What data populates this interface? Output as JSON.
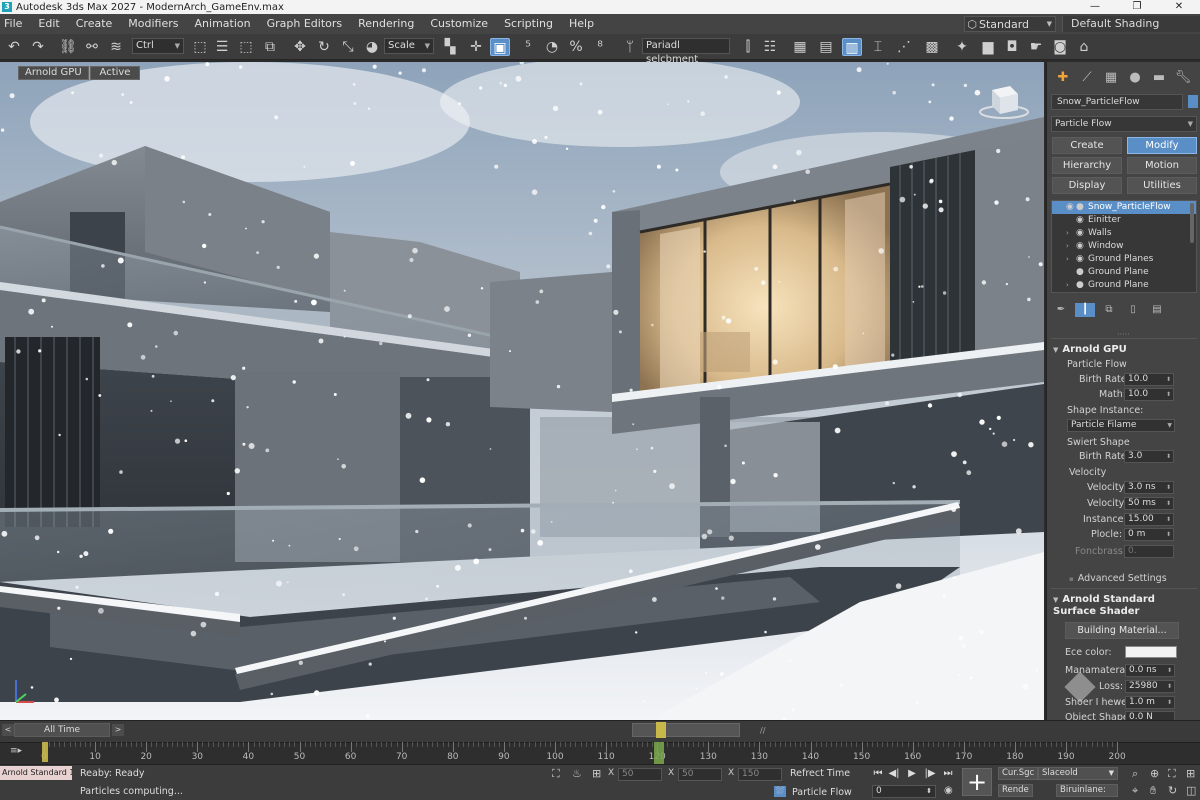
{
  "window": {
    "title": "Autodesk 3ds Max 2027 - ModernArch_GameEnv.max",
    "app_icon": "3",
    "minimize": "—",
    "restore": "❐",
    "close": "✕"
  },
  "menu": [
    "File",
    "Edit",
    "Create",
    "Modifiers",
    "Animation",
    "Graph Editors",
    "Rendering",
    "Customize",
    "Scripting",
    "Help"
  ],
  "workspace": {
    "label": "Standard",
    "shading": "Default Shading"
  },
  "toolbar": {
    "selection_filter": "Ctrl",
    "transform_dropdown": "Scale",
    "named_selection": "Pariadl selcbment"
  },
  "viewport": {
    "renderer_label": "Arnold GPU",
    "state_label": "Active",
    "scene": "Snowy modern concrete architecture with glass railings and lit window"
  },
  "command_panel": {
    "object_name": "Snow_ParticleFlow",
    "modifier_list": "Particle Flow",
    "buttons": [
      "Create",
      "Modify",
      "Hierarchy",
      "Motion",
      "Display",
      "Utilities"
    ],
    "active_button": "Modify",
    "tree": [
      {
        "name": "Snow_ParticleFlow",
        "selected": true,
        "expand": ""
      },
      {
        "name": "Einitter",
        "selected": false,
        "expand": ""
      },
      {
        "name": "Walls",
        "selected": false,
        "expand": "›"
      },
      {
        "name": "Window",
        "selected": false,
        "expand": "›"
      },
      {
        "name": "Ground Planes",
        "selected": false,
        "expand": "›"
      },
      {
        "name": "Ground Plane",
        "selected": false,
        "expand": ""
      },
      {
        "name": "Ground Plane",
        "selected": false,
        "expand": "›"
      }
    ],
    "rollout1": {
      "title": "Arnold GPU",
      "sub": "Particle Flow",
      "birth_rate_label": "Birth Rate:",
      "birth_rate": "10.0",
      "math_label": "Math:",
      "math": "10.0",
      "shape_instance_label": "Shape Instance:",
      "shape_instance": "Particle Filame",
      "swiert_label": "Swiert Shape",
      "birth_rate2_label": "Birth Rate:",
      "birth_rate2": "3.0",
      "velocity_label": "Velocity",
      "velocity1_label": "Velocity:",
      "velocity1": "3.0 ns",
      "velocity2_label": "Velocity:",
      "velocity2": "50 ms",
      "instance_label": "Instance:",
      "instance": "15.00",
      "plocle_label": "Plocle:",
      "plocle": "0 m",
      "foncbrass_label": "Foncbrass:",
      "foncbrass": "0.",
      "advanced": "Advanced Settings"
    },
    "rollout2": {
      "title": "Arnold Standard Surface Shader",
      "material_button": "Building Material...",
      "ece_label": "Ece color:",
      "mana_label": "Manamateral:",
      "mana": "0.0 ns",
      "loss_label": "Loss:",
      "loss": "25980",
      "shoer_label": "Shoer I hewe:",
      "shoer": "1.0 m",
      "object_label": "Object Shape:",
      "object": "0.0 N"
    }
  },
  "timeline": {
    "all_time": "All Time",
    "ticks": [
      0,
      10,
      20,
      30,
      40,
      50,
      60,
      70,
      80,
      90,
      100,
      110,
      120,
      130,
      130,
      140,
      150,
      160,
      170,
      180,
      190,
      200
    ],
    "current_frame": 120,
    "slider_label": "/∕"
  },
  "status": {
    "maxscript": "Arnold Standard 15:",
    "line1": "Reaby: Ready",
    "line2": "Particles computing...",
    "x_label": "X",
    "x_val": "50",
    "y_label": "X",
    "y_val": "50",
    "z_label": "X",
    "z_val": "150",
    "refresh_time": "Refrect Time",
    "particle_flow": "Particle Flow",
    "cur_sgc": "Cur.Sgc",
    "render": "Rende",
    "slaceold": "Slaceold",
    "biruinlane": "Biruinlane:",
    "frame_field": "0"
  }
}
